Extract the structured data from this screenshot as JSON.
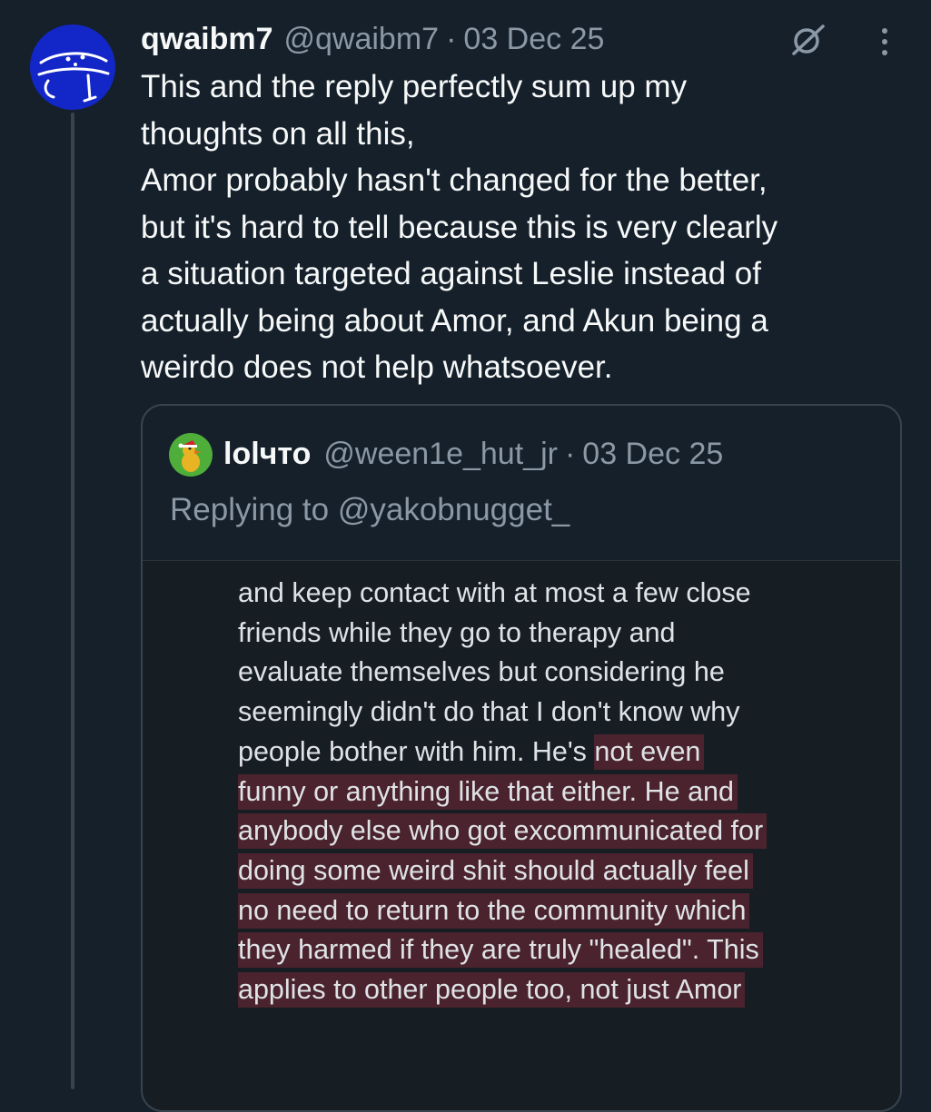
{
  "post": {
    "display_name": "qwaibm7",
    "handle": "@qwaibm7",
    "separator": "·",
    "date": "03 Dec 25",
    "lines": [
      "This and the reply perfectly sum up my",
      "thoughts on all this,",
      "Amor probably hasn't changed for the better,",
      "but it's hard to tell because this is very clearly",
      "a situation targeted against Leslie instead of",
      "actually being about Amor, and Akun being a",
      "weirdo does not help whatsoever."
    ]
  },
  "icons": {
    "avatar": "drawn-face-avatar",
    "grok": "grok-slash-circle-icon",
    "more": "more-vertical-icon"
  },
  "quote": {
    "display_name": "lolчто",
    "handle": "@ween1e_hut_jr",
    "separator": "·",
    "date": "03 Dec 25",
    "replying_to": "Replying to @yakobnugget_",
    "screenshot_text": {
      "plain_lines": [
        "and keep contact with at most a few close",
        "friends while they go to therapy and",
        "evaluate themselves but considering he",
        "seemingly didn't do that I don't know why"
      ],
      "mixed_line": {
        "plain": "people bother with him. He's ",
        "highlighted": "not even"
      },
      "highlighted_lines": [
        "funny or anything like that either. He and",
        "anybody else who got excommunicated for",
        "doing some weird shit should actually feel",
        "no need to return to the community which",
        "they harmed if they are truly \"healed\". This",
        "applies to other people too, not just Amor"
      ]
    }
  },
  "colors": {
    "background": "#15202b",
    "text_primary": "#f7f9f9",
    "text_secondary": "#8b98a5",
    "border": "#38444d",
    "highlight": "#4a232e",
    "avatar_blue": "#1327c8",
    "quote_avatar_green": "#4fae3a"
  }
}
